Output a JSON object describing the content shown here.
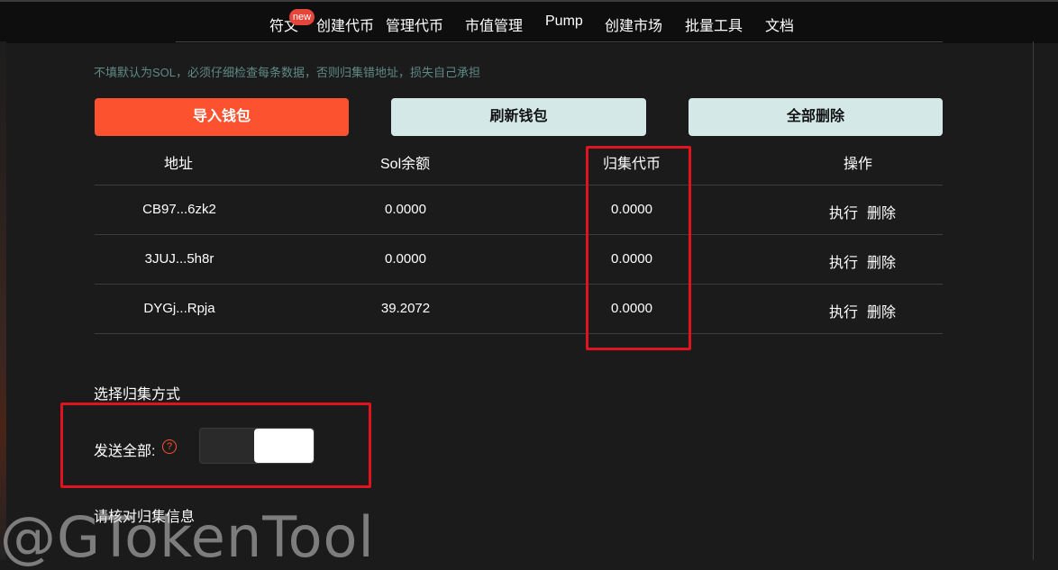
{
  "nav": {
    "items": [
      "符文",
      "创建代币",
      "管理代币",
      "市值管理",
      "Pump",
      "创建市场",
      "批量工具",
      "文档"
    ],
    "badge": "new"
  },
  "hint": "不填默认为SOL，必须仔细检查每条数据，否则归集错地址，损失自己承担",
  "buttons": {
    "import": "导入钱包",
    "refresh": "刷新钱包",
    "delete_all": "全部删除"
  },
  "table": {
    "headers": [
      "地址",
      "Sol余额",
      "归集代币",
      "操作"
    ],
    "rows": [
      {
        "address": "CB97...6zk2",
        "sol": "0.0000",
        "token": "0.0000",
        "exec": "执行",
        "delete": "删除"
      },
      {
        "address": "3JUJ...5h8r",
        "sol": "0.0000",
        "token": "0.0000",
        "exec": "执行",
        "delete": "删除"
      },
      {
        "address": "DYGj...Rpja",
        "sol": "39.2072",
        "token": "0.0000",
        "exec": "执行",
        "delete": "删除"
      }
    ]
  },
  "collect_method": {
    "title": "选择归集方式",
    "send_all_label": "发送全部:",
    "help_icon": "?",
    "send_all_on": true
  },
  "verify_title": "请核对归集信息",
  "watermark": "@GTokenTool",
  "colors": {
    "accent": "#fc5230",
    "light_button": "#d4e8e8",
    "highlight": "#e0141e",
    "hint": "#5f8a86"
  }
}
